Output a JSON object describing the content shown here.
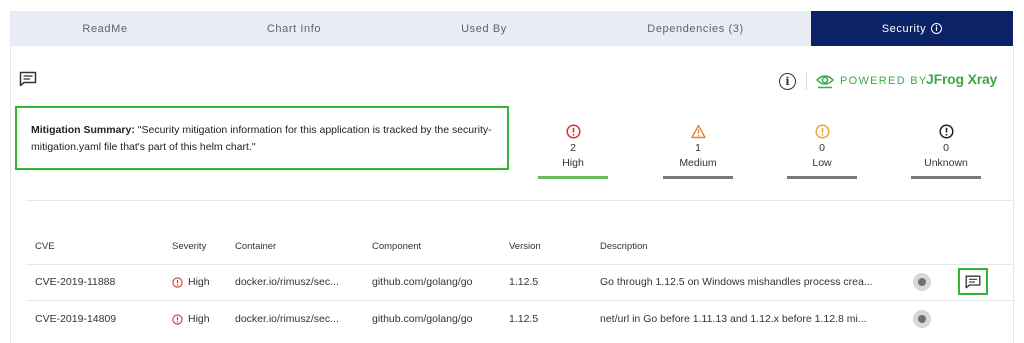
{
  "tabs": [
    {
      "label": "ReadMe"
    },
    {
      "label": "Chart Info"
    },
    {
      "label": "Used By"
    },
    {
      "label": "Dependencies (3)"
    },
    {
      "label": "Security",
      "active": true
    }
  ],
  "header": {
    "powered_by": "POWERED BY",
    "brand": "JFrog Xray",
    "info_icon": "info-icon",
    "eye_icon": "eye-icon",
    "comment_icon": "comment-icon"
  },
  "mitigation": {
    "label": "Mitigation Summary:",
    "text": " \"Security mitigation information for this application is tracked by the security-mitigation.yaml file that's part of this helm chart.\""
  },
  "severity_summary": [
    {
      "count": "2",
      "label": "High",
      "color": "#d9362b",
      "icon": "error-circle-icon"
    },
    {
      "count": "1",
      "label": "Medium",
      "color": "#e8822b",
      "icon": "warning-triangle-icon"
    },
    {
      "count": "0",
      "label": "Low",
      "color": "#e9a63a",
      "icon": "alert-circle-icon"
    },
    {
      "count": "0",
      "label": "Unknown",
      "color": "#222222",
      "icon": "alert-circle-icon"
    }
  ],
  "table": {
    "headers": [
      "CVE",
      "Severity",
      "Container",
      "Component",
      "Version",
      "Description"
    ],
    "rows": [
      {
        "cve": "CVE-2019-11888",
        "severity": "High",
        "container": "docker.io/rimusz/sec...",
        "component": "github.com/golang/go",
        "version": "1.12.5",
        "description": "Go through 1.12.5 on Windows mishandles process crea..."
      },
      {
        "cve": "CVE-2019-14809",
        "severity": "High",
        "container": "docker.io/rimusz/sec...",
        "component": "github.com/golang/go",
        "version": "1.12.5",
        "description": "net/url in Go before 1.11.13 and 1.12.x before 1.12.8 mi..."
      }
    ]
  },
  "colors": {
    "active_tab_bg": "#0c2266",
    "tab_bar_bg": "#e8edf5",
    "highlight_green": "#35b535",
    "brand_green": "#40a548",
    "high_red": "#d9362b"
  }
}
